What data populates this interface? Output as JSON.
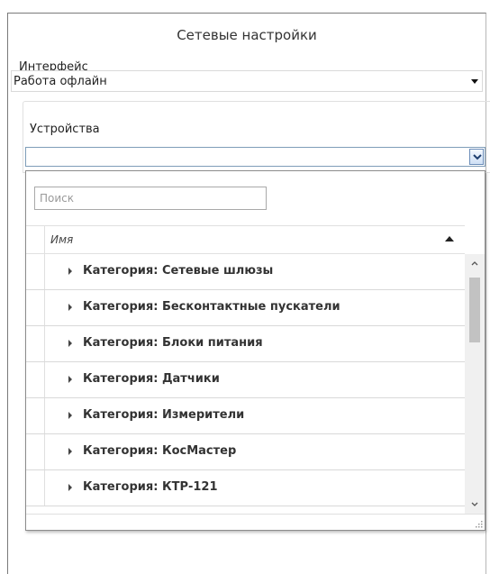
{
  "window": {
    "title": "Сетевые настройки"
  },
  "interface": {
    "label": "Интерфейс",
    "selected": "Работа офлайн"
  },
  "devices": {
    "label": "Устройства",
    "selected": ""
  },
  "dropdown": {
    "search_placeholder": "Поиск",
    "search_value": "",
    "column_header": "Имя",
    "sort": "ascending",
    "items": [
      {
        "label": "Категория: Сетевые шлюзы"
      },
      {
        "label": "Категория: Бесконтактные пускатели"
      },
      {
        "label": "Категория: Блоки питания"
      },
      {
        "label": "Категория: Датчики"
      },
      {
        "label": "Категория: Измерители"
      },
      {
        "label": "Категория: КосМастер"
      },
      {
        "label": "Категория: КТР-121"
      }
    ]
  },
  "icons": {
    "iface_caret": "chevron-down-icon",
    "combo_button": "chevron-down-icon",
    "sort": "sort-ascending-icon",
    "row_expander": "caret-right-icon",
    "scroll_up": "chevron-up-icon",
    "scroll_down": "chevron-down-icon",
    "resize": "resize-grip-icon"
  },
  "colors": {
    "combo_border": "#7f9db9",
    "scrollbar_thumb": "#c2c2c2",
    "row_divider": "#d9d9d9"
  }
}
